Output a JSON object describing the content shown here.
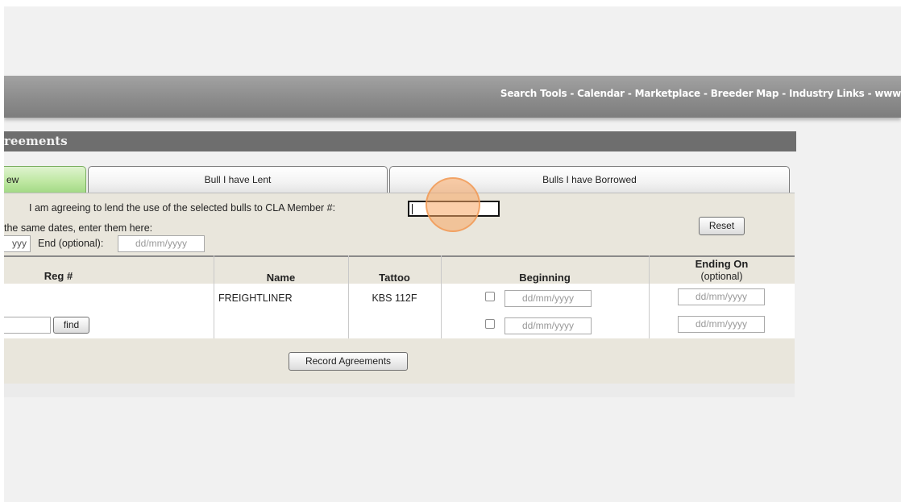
{
  "topnav": {
    "links": "Search Tools - Calendar - Marketplace - Breeder Map - Industry Links - www"
  },
  "section": {
    "title": "reements"
  },
  "tabs": [
    {
      "label": "ew"
    },
    {
      "label": "Bull I have Lent"
    },
    {
      "label": "Bulls I have Borrowed"
    }
  ],
  "form": {
    "member_prompt": "I am agreeing to lend the use of the selected bulls to CLA Member #:",
    "member_value": "",
    "same_dates_text": "the same dates, enter them here:",
    "start_partial": "yyy",
    "end_label": "End (optional):",
    "end_placeholder": "dd/mm/yyyy",
    "reset_label": "Reset"
  },
  "table": {
    "headers": {
      "reg": "Reg #",
      "name": "Name",
      "tattoo": "Tattoo",
      "beginning": "Beginning",
      "ending": "Ending On",
      "ending_sub": "(optional)"
    },
    "rows": [
      {
        "reg": "",
        "name": "FREIGHTLINER",
        "tattoo": "KBS 112F",
        "begin_placeholder": "dd/mm/yyyy",
        "end_placeholder": "dd/mm/yyyy"
      },
      {
        "reg_input": "",
        "find_label": "find",
        "begin_placeholder": "dd/mm/yyyy",
        "end_placeholder": "dd/mm/yyyy"
      }
    ]
  },
  "actions": {
    "record_label": "Record Agreements"
  }
}
